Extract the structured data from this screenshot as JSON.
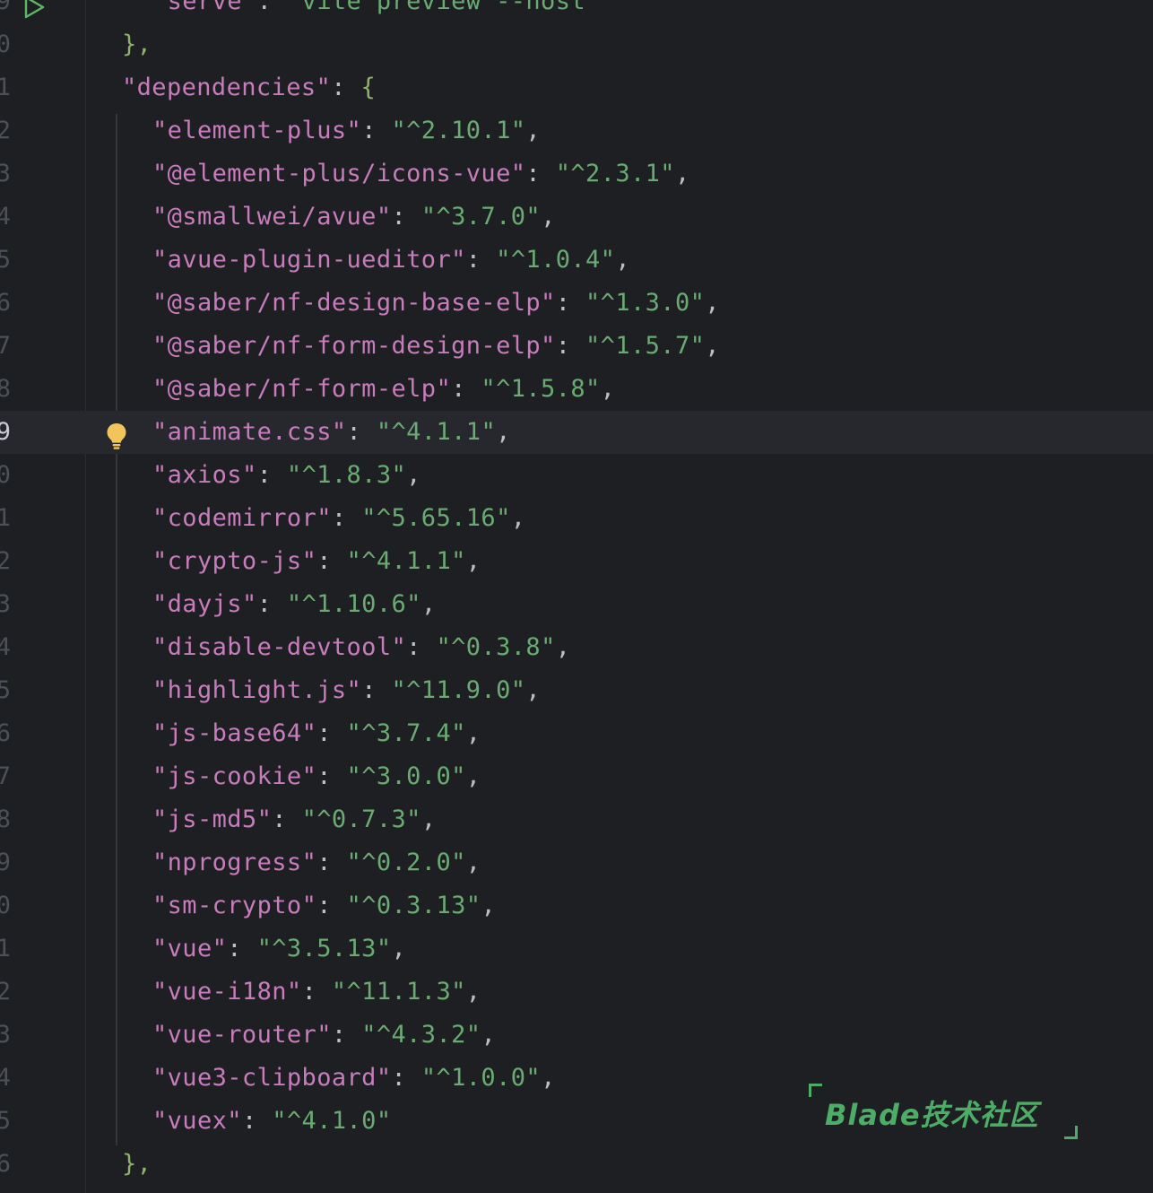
{
  "editor": {
    "lines": [
      {
        "ln": "9",
        "key": "serve",
        "value": "vite preview --host",
        "comma": ""
      },
      {
        "ln": "0",
        "text": "},"
      },
      {
        "ln": "1",
        "key": "dependencies",
        "open": "{"
      },
      {
        "ln": "2",
        "key": "element-plus",
        "value": "^2.10.1",
        "comma": ","
      },
      {
        "ln": "3",
        "key": "@element-plus/icons-vue",
        "value": "^2.3.1",
        "comma": ","
      },
      {
        "ln": "4",
        "key": "@smallwei/avue",
        "value": "^3.7.0",
        "comma": ","
      },
      {
        "ln": "5",
        "key": "avue-plugin-ueditor",
        "value": "^1.0.4",
        "comma": ","
      },
      {
        "ln": "6",
        "key": "@saber/nf-design-base-elp",
        "value": "^1.3.0",
        "comma": ","
      },
      {
        "ln": "7",
        "key": "@saber/nf-form-design-elp",
        "value": "^1.5.7",
        "comma": ","
      },
      {
        "ln": "8",
        "key": "@saber/nf-form-elp",
        "value": "^1.5.8",
        "comma": ","
      },
      {
        "ln": "9",
        "key": "animate.css",
        "value": "^4.1.1",
        "comma": ","
      },
      {
        "ln": "0",
        "key": "axios",
        "value": "^1.8.3",
        "comma": ","
      },
      {
        "ln": "1",
        "key": "codemirror",
        "value": "^5.65.16",
        "comma": ","
      },
      {
        "ln": "2",
        "key": "crypto-js",
        "value": "^4.1.1",
        "comma": ","
      },
      {
        "ln": "3",
        "key": "dayjs",
        "value": "^1.10.6",
        "comma": ","
      },
      {
        "ln": "4",
        "key": "disable-devtool",
        "value": "^0.3.8",
        "comma": ","
      },
      {
        "ln": "5",
        "key": "highlight.js",
        "value": "^11.9.0",
        "comma": ","
      },
      {
        "ln": "6",
        "key": "js-base64",
        "value": "^3.7.4",
        "comma": ","
      },
      {
        "ln": "7",
        "key": "js-cookie",
        "value": "^3.0.0",
        "comma": ","
      },
      {
        "ln": "8",
        "key": "js-md5",
        "value": "^0.7.3",
        "comma": ","
      },
      {
        "ln": "9",
        "key": "nprogress",
        "value": "^0.2.0",
        "comma": ","
      },
      {
        "ln": "0",
        "key": "sm-crypto",
        "value": "^0.3.13",
        "comma": ","
      },
      {
        "ln": "1",
        "key": "vue",
        "value": "^3.5.13",
        "comma": ","
      },
      {
        "ln": "2",
        "key": "vue-i18n",
        "value": "^11.1.3",
        "comma": ","
      },
      {
        "ln": "3",
        "key": "vue-router",
        "value": "^4.3.2",
        "comma": ","
      },
      {
        "ln": "4",
        "key": "vue3-clipboard",
        "value": "^1.0.0",
        "comma": ","
      },
      {
        "ln": "5",
        "key": "vuex",
        "value": "^4.1.0",
        "comma": ""
      },
      {
        "ln": "6",
        "text": "},"
      }
    ],
    "current_line_index": 10
  },
  "icons": {
    "run": "run-icon",
    "bulb": "lightbulb-icon"
  },
  "colors": {
    "background": "#1e1f22",
    "current_line": "#26282e",
    "key": "#c77dbb",
    "string": "#6aab73",
    "punctuation": "#bcbec4",
    "run_icon": "#5fb865",
    "bulb_icon": "#f2c55c",
    "watermark": "#4cae66"
  },
  "watermark": {
    "text": "Blade技术社区"
  }
}
